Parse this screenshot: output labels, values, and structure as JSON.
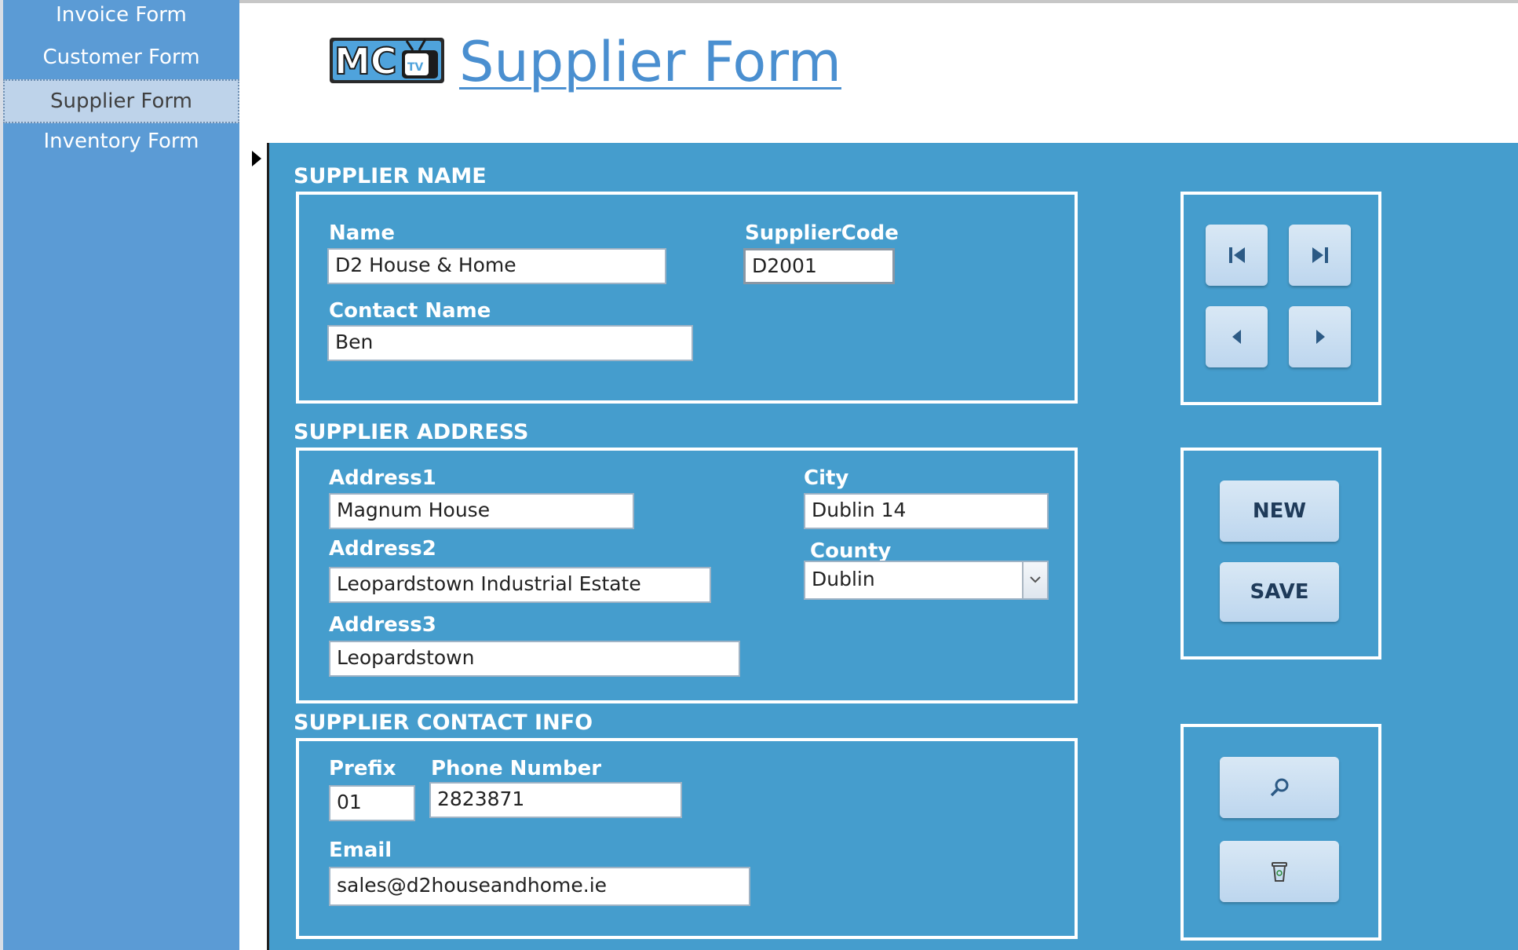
{
  "nav": {
    "items": [
      {
        "label": "Invoice Form"
      },
      {
        "label": "Customer Form"
      },
      {
        "label": "Supplier Form"
      },
      {
        "label": "Inventory Form"
      }
    ]
  },
  "header": {
    "logo_text": "MC",
    "logo_tv": "TV",
    "title": "Supplier Form"
  },
  "sections": {
    "name": {
      "label": "SUPPLIER NAME",
      "name_label": "Name",
      "name_value": "D2 House & Home",
      "code_label": "SupplierCode",
      "code_value": "D2001",
      "contact_label": "Contact Name",
      "contact_value": "Ben"
    },
    "address": {
      "label": "SUPPLIER ADDRESS",
      "address1_label": "Address1",
      "address1_value": "Magnum House",
      "address2_label": "Address2",
      "address2_value": "Leopardstown Industrial Estate",
      "address3_label": "Address3",
      "address3_value": "Leopardstown",
      "city_label": "City",
      "city_value": "Dublin 14",
      "county_label": "County",
      "county_value": "Dublin"
    },
    "contact": {
      "label": "SUPPLIER CONTACT INFO",
      "prefix_label": "Prefix",
      "prefix_value": "01",
      "phone_label": "Phone Number",
      "phone_value": "2823871",
      "email_label": "Email",
      "email_value": "sales@d2houseandhome.ie"
    }
  },
  "buttons": {
    "new_label": "NEW",
    "save_label": "SAVE",
    "icons": [
      "first-record-icon",
      "last-record-icon",
      "previous-record-icon",
      "next-record-icon",
      "search-icon",
      "delete-icon"
    ]
  },
  "colors": {
    "nav_bg": "#5b9bd5",
    "form_bg": "#459dcd",
    "title": "#4a8fd0",
    "button_bg": "#c9def2"
  }
}
